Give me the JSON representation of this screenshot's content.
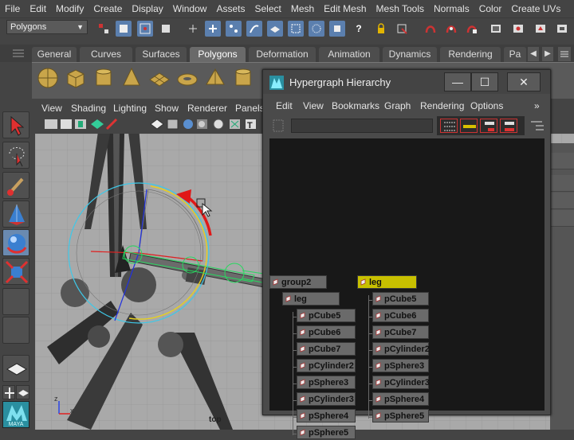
{
  "menubar": [
    "File",
    "Edit",
    "Modify",
    "Create",
    "Display",
    "Window",
    "Assets",
    "Select",
    "Mesh",
    "Edit Mesh",
    "Mesh Tools",
    "Normals",
    "Color",
    "Create UVs"
  ],
  "mode_select": "Polygons",
  "shelf_tabs": [
    "General",
    "Curves",
    "Surfaces",
    "Polygons",
    "Deformation",
    "Animation",
    "Dynamics",
    "Rendering",
    "Pa"
  ],
  "active_shelf_tab": "Polygons",
  "panel_menu": [
    "View",
    "Shading",
    "Lighting",
    "Show",
    "Renderer",
    "Panels"
  ],
  "viewport": {
    "camera_label": "top"
  },
  "toolbox": {
    "logo_text": "MAYA"
  },
  "hypergraph": {
    "title": "Hypergraph Hierarchy",
    "menu": [
      "Edit",
      "View",
      "Bookmarks",
      "Graph",
      "Rendering",
      "Options"
    ],
    "more": "»",
    "window_buttons": {
      "minimize": "—",
      "maximize": "☐",
      "close": "✕"
    },
    "tree1": {
      "root": "group2",
      "child": "leg",
      "leaves": [
        "pCube5",
        "pCube6",
        "pCube7",
        "pCylinder2",
        "pSphere3",
        "pCylinder3",
        "pSphere4",
        "pSphere5"
      ]
    },
    "tree2": {
      "root": "leg",
      "leaves": [
        "pCube5",
        "pCube6",
        "pCube7",
        "pCylinder2",
        "pSphere3",
        "pCylinder3",
        "pSphere4",
        "pSphere5"
      ]
    }
  },
  "colors": {
    "selected_node": "#c8c000",
    "node": "#6a6a6a",
    "canvas": "#181818",
    "viewport_bg": "#a9a9a9"
  }
}
